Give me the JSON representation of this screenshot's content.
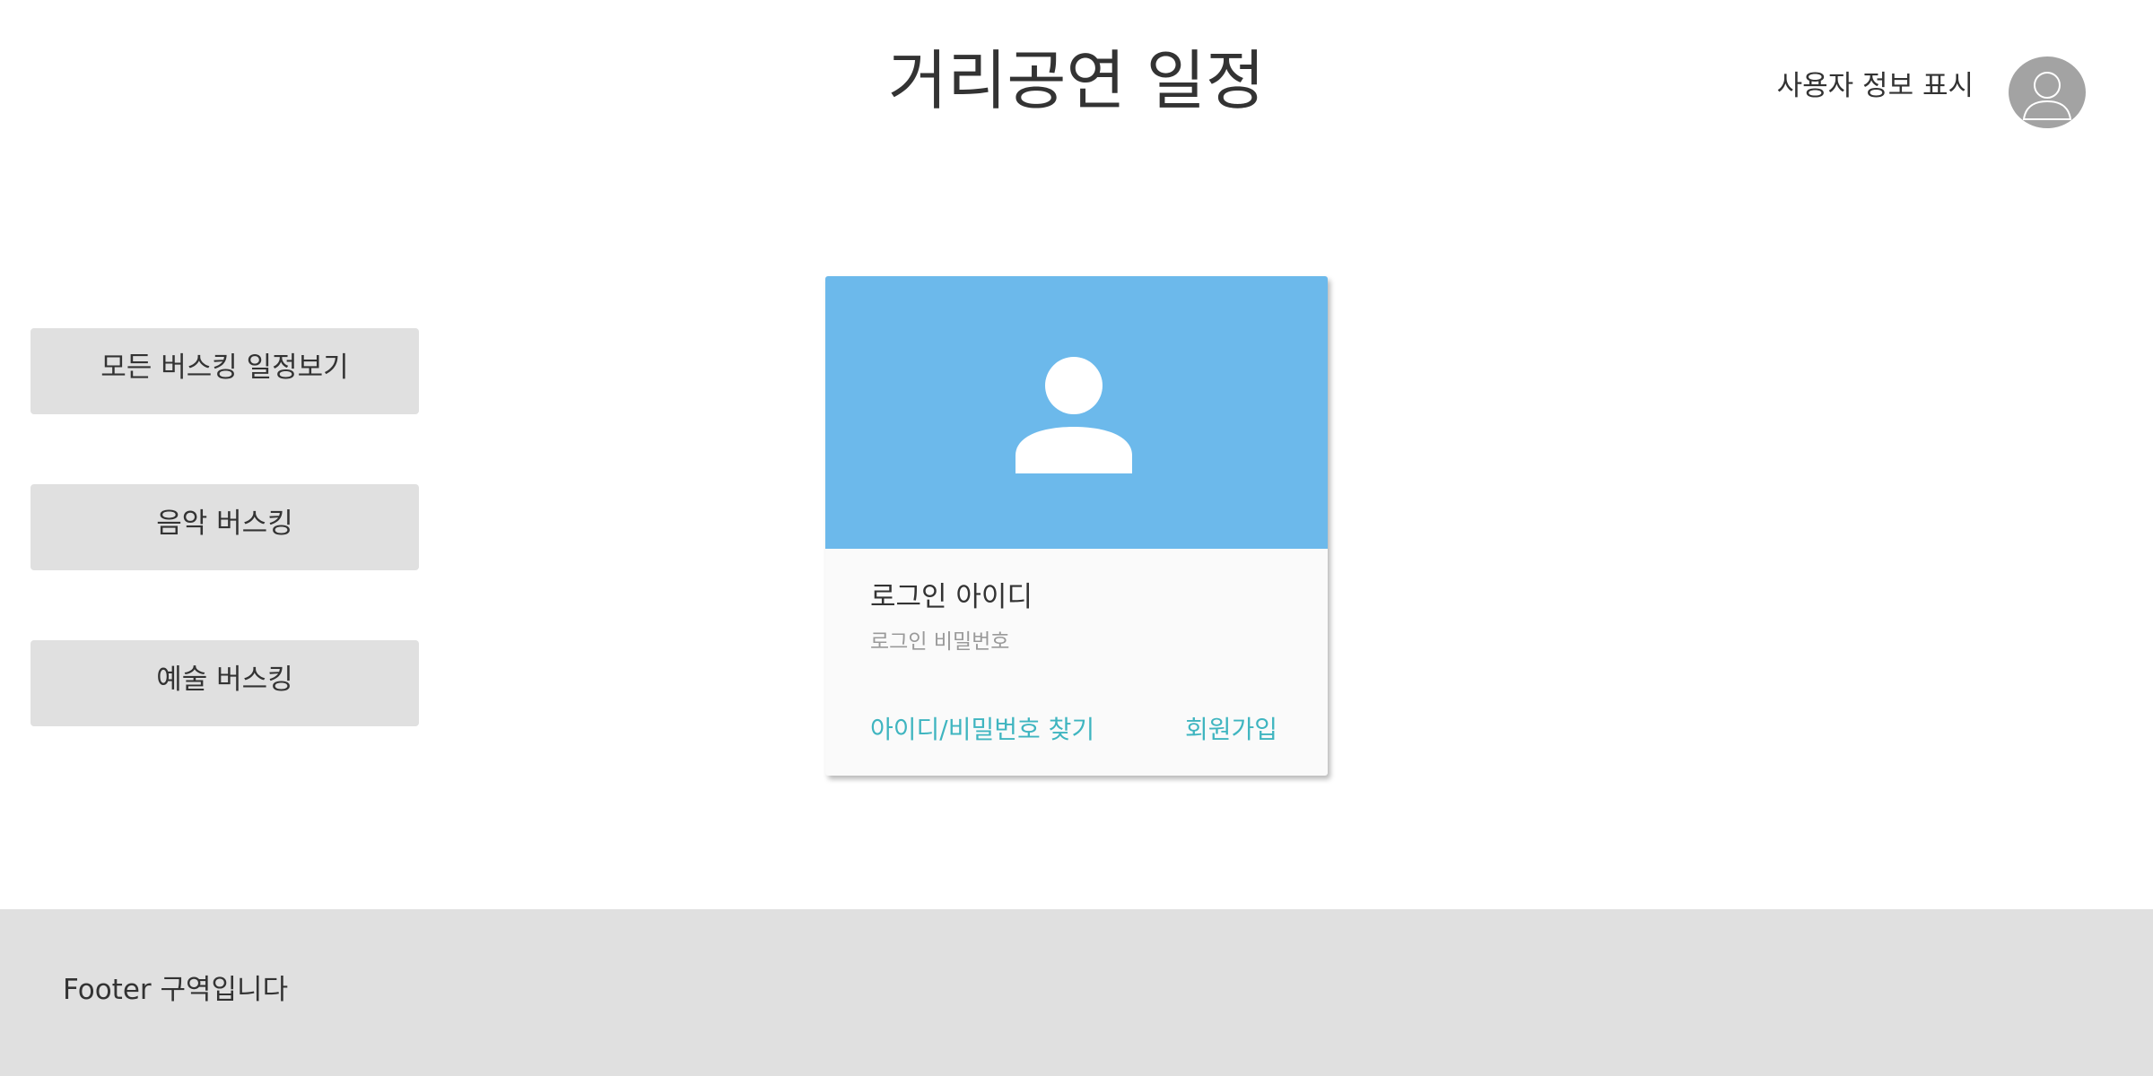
{
  "header": {
    "title": "거리공연 일정",
    "user_info": "사용자 정보 표시",
    "avatar_icon": "user-silhouette-icon"
  },
  "sidebar": {
    "items": [
      {
        "label": "모든 버스킹 일정보기"
      },
      {
        "label": "음악 버스킹"
      },
      {
        "label": "예술 버스킹"
      }
    ]
  },
  "login_card": {
    "banner_color": "#6cb9eb",
    "banner_icon": "user-icon",
    "id_placeholder": "로그인 아이디",
    "password_placeholder": "로그인 비밀번호",
    "find_link": "아이디/비밀번호 찾기",
    "signup_link": "회원가입",
    "link_color": "#3fb5c0"
  },
  "footer": {
    "text": "Footer 구역입니다"
  }
}
